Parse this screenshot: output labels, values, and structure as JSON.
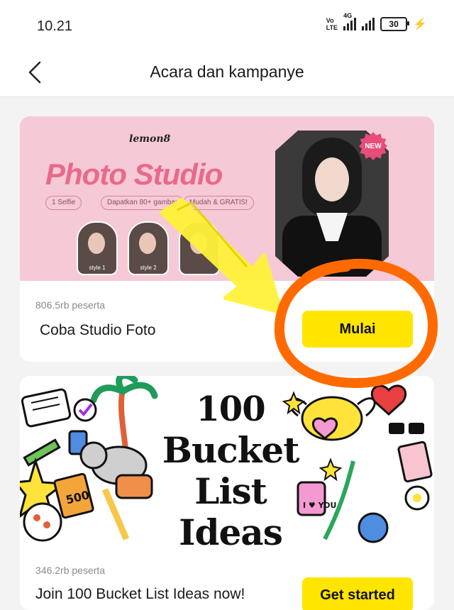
{
  "status_bar": {
    "time": "10.21",
    "volte_top": "Vo",
    "volte_bottom": "LTE",
    "network": "4G",
    "battery": "30"
  },
  "header": {
    "title": "Acara dan kampanye",
    "back_icon": "chevron-left-icon"
  },
  "campaigns": [
    {
      "banner": {
        "brand": "lemon8",
        "headline": "Photo Studio",
        "pills": [
          "1 Selfie",
          "Dapatkan 80+ gambar",
          "Mudah & GRATIS!"
        ],
        "badge": "NEW",
        "thumbnails": [
          "style 1",
          "style 2"
        ]
      },
      "participants": "806.5rb peserta",
      "title": "Coba Studio Foto",
      "button_label": "Mulai"
    },
    {
      "banner": {
        "headline_lines": [
          "100",
          "Bucket",
          "List",
          "Ideas"
        ],
        "stickers": [
          "500",
          "I ♥ YOU"
        ]
      },
      "participants": "346.2rb peserta",
      "title": "Join 100 Bucket List Ideas now!",
      "button_label": "Get started"
    }
  ],
  "annotations": {
    "arrow_color": "#fff23a",
    "circle_color": "#ff6a00"
  },
  "colors": {
    "accent_button": "#ffe500",
    "banner_pink": "#f6c9d6",
    "headline_pink": "#e86a8a"
  }
}
